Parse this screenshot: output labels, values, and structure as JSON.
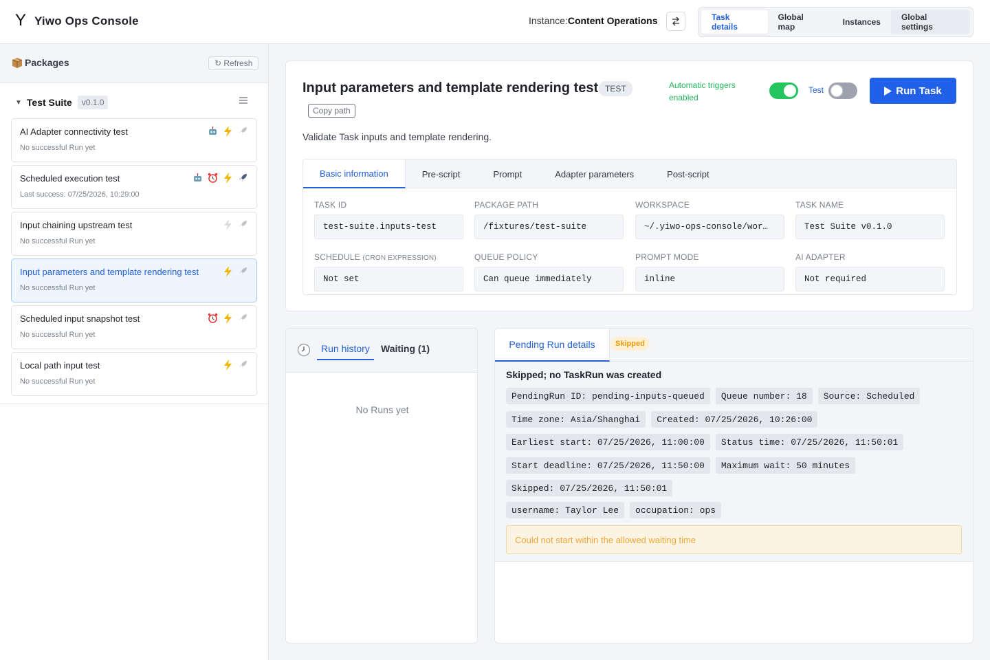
{
  "header": {
    "logo_glyph": "Y",
    "title": "Yiwo Ops Console",
    "instance_label": "Instance:",
    "instance_name": "Content Operations",
    "nav": [
      {
        "label": "Task details",
        "active": true
      },
      {
        "label": "Global map"
      },
      {
        "label": "Instances"
      },
      {
        "label": "Global settings"
      }
    ]
  },
  "sidebar": {
    "title": "Packages",
    "refresh_label": "↻ Refresh",
    "suite": {
      "name": "Test Suite",
      "version": "v0.1.0"
    },
    "tasks": [
      {
        "name": "AI Adapter connectivity test",
        "status": "No successful Run yet",
        "icons": [
          "robot-icon",
          "lightning-icon",
          "rocket-icon"
        ]
      },
      {
        "name": "Scheduled execution test",
        "status": "Last success: 07/25/2026, 10:29:00",
        "icons": [
          "robot-icon",
          "alarm-clock-icon",
          "lightning-icon",
          "rocket-icon"
        ]
      },
      {
        "name": "Input chaining upstream test",
        "status": "No successful Run yet",
        "icons": [
          "lightning-icon",
          "rocket-icon"
        ]
      },
      {
        "name": "Input parameters and template rendering test",
        "status": "No successful Run yet",
        "icons": [
          "lightning-icon",
          "rocket-icon"
        ],
        "active": true
      },
      {
        "name": "Scheduled input snapshot test",
        "status": "No successful Run yet",
        "icons": [
          "alarm-clock-icon",
          "lightning-icon",
          "rocket-icon"
        ]
      },
      {
        "name": "Local path input test",
        "status": "No successful Run yet",
        "icons": [
          "lightning-icon",
          "rocket-icon"
        ]
      }
    ]
  },
  "task": {
    "title": "Input parameters and template rendering test",
    "badge": "TEST",
    "copy_path": "Copy path",
    "auto_triggers": "Automatic triggers enabled",
    "auto_triggers_on": true,
    "test_label": "Test",
    "test_on": false,
    "run_label": "Run Task",
    "description": "Validate Task inputs and template rendering.",
    "tabs": [
      "Basic information",
      "Pre-script",
      "Prompt",
      "Adapter parameters",
      "Post-script"
    ],
    "fields": {
      "task_id": {
        "label": "TASK ID",
        "value": "test-suite.inputs-test"
      },
      "package_path": {
        "label": "PACKAGE PATH",
        "value": "/fixtures/test-suite"
      },
      "workspace": {
        "label": "WORKSPACE",
        "value": "~/.yiwo-ops-console/wor…"
      },
      "task_name": {
        "label": "TASK NAME",
        "value": "Test Suite v0.1.0"
      },
      "schedule": {
        "label": "SCHEDULE",
        "label_note": "(CRON EXPRESSION)",
        "value": "Not set"
      },
      "queue_policy": {
        "label": "QUEUE POLICY",
        "value": "Can queue immediately"
      },
      "prompt_mode": {
        "label": "PROMPT MODE",
        "value": "inline"
      },
      "ai_adapter": {
        "label": "AI ADAPTER",
        "value": "Not required"
      }
    }
  },
  "history": {
    "tab_history": "Run history",
    "tab_waiting": "Waiting (1)",
    "empty": "No Runs yet"
  },
  "pending": {
    "tab": "Pending Run details",
    "badge": "Skipped",
    "title": "Skipped; no TaskRun was created",
    "rows": [
      [
        "PendingRun ID: pending-inputs-queued",
        "Queue number: 18",
        "Source: Scheduled"
      ],
      [
        "Time zone: Asia/Shanghai",
        "Created: 07/25/2026, 10:26:00"
      ],
      [
        "Earliest start: 07/25/2026, 11:00:00",
        "Status time: 07/25/2026, 11:50:01"
      ],
      [
        "Start deadline: 07/25/2026, 11:50:00",
        "Maximum wait: 50 minutes"
      ],
      [
        "Skipped: 07/25/2026, 11:50:01"
      ],
      [
        "username: Taylor Lee",
        "occupation: ops"
      ]
    ],
    "warning": "Could not start within the allowed waiting time"
  }
}
